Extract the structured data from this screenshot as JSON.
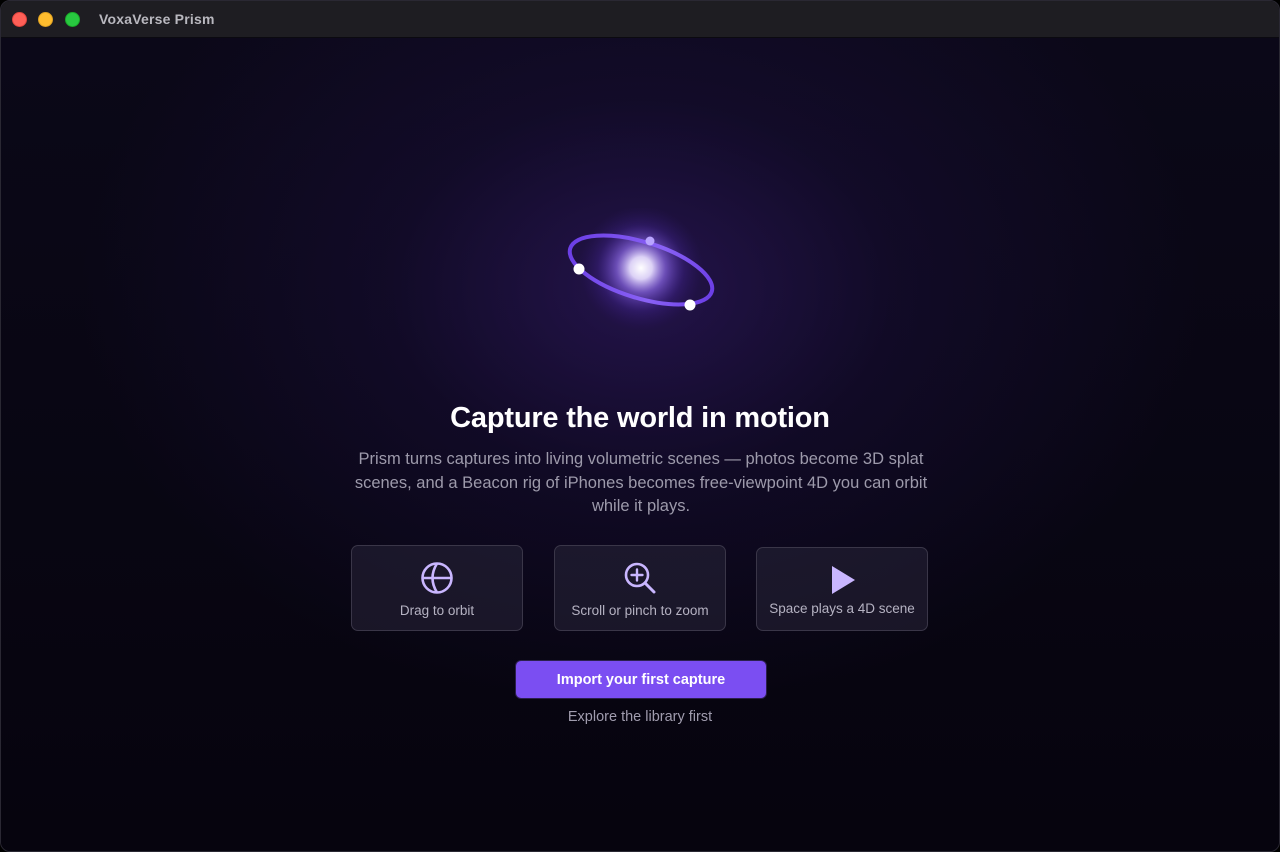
{
  "window": {
    "title": "VoxaVerse Prism",
    "controls": {
      "close": "close-window",
      "minimize": "minimize-window",
      "zoom": "zoom-window"
    }
  },
  "hero": {
    "icon": "orbit-glow-icon",
    "headline": "Capture the world in motion",
    "description": "Prism turns captures into living volumetric scenes — photos become 3D splat scenes, and a Beacon rig of iPhones becomes free-viewpoint 4D you can orbit while it plays."
  },
  "hints": [
    {
      "icon": "globe-orbit-icon",
      "label": "Drag to orbit"
    },
    {
      "icon": "zoom-in-icon",
      "label": "Scroll or pinch to zoom"
    },
    {
      "icon": "play-icon",
      "label": "Space plays a 4D scene"
    }
  ],
  "actions": {
    "primary_label": "Import your first capture",
    "secondary_label": "Explore the library first"
  },
  "colors": {
    "accent": "#7b4ef2",
    "accent_light": "#c9b6ff",
    "background": "#06040f"
  }
}
